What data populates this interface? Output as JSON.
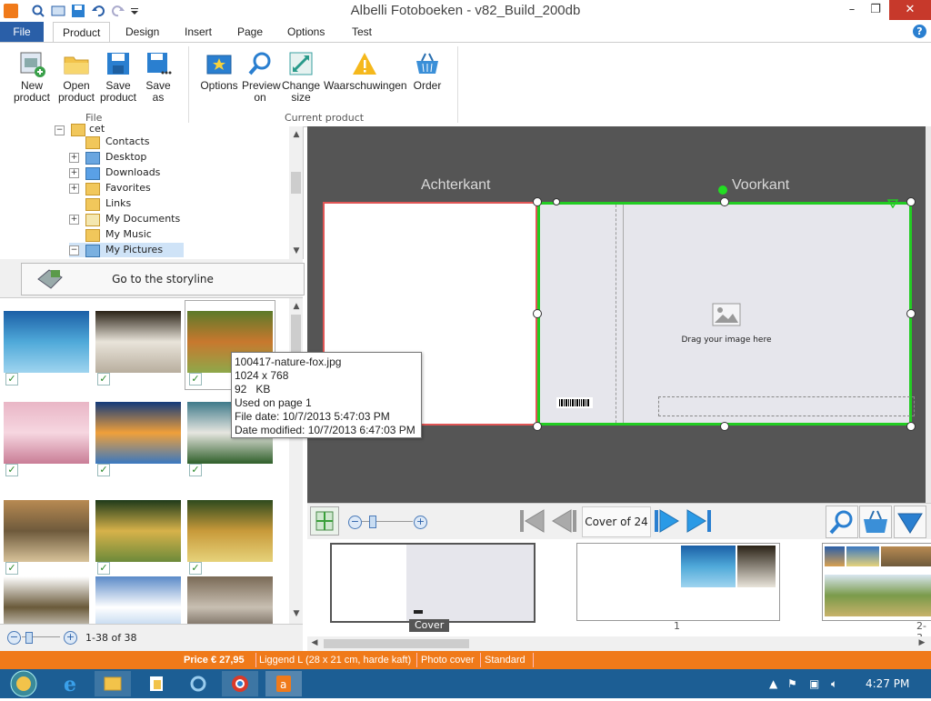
{
  "window": {
    "title": "Albelli Fotoboeken - v82_Build_200db",
    "controls": [
      "–",
      "❐",
      "✕"
    ],
    "help": "?"
  },
  "tabs": [
    "File",
    "Product",
    "Design",
    "Insert",
    "Page",
    "Options",
    "Test"
  ],
  "ribbon": {
    "file_group": {
      "label": "File",
      "buttons": [
        {
          "line1": "New",
          "line2": "product",
          "icon": "new-product-icon"
        },
        {
          "line1": "Open",
          "line2": "product",
          "icon": "open-folder-icon"
        },
        {
          "line1": "Save",
          "line2": "product",
          "icon": "save-icon"
        },
        {
          "line1": "Save",
          "line2": "as",
          "icon": "save-as-icon"
        }
      ]
    },
    "current_group": {
      "label": "Current product",
      "buttons": [
        {
          "line1": "Options",
          "line2": "",
          "icon": "options-icon"
        },
        {
          "line1": "Preview",
          "line2": "on",
          "icon": "preview-icon"
        },
        {
          "line1": "Change",
          "line2": "size",
          "icon": "change-size-icon"
        },
        {
          "line1": "Waarschuwingen",
          "line2": "",
          "icon": "warning-icon"
        },
        {
          "line1": "Order",
          "line2": "",
          "icon": "basket-icon"
        }
      ]
    }
  },
  "tree": {
    "items": [
      {
        "label": "cet",
        "expander": "−"
      },
      {
        "label": "Contacts",
        "expander": ""
      },
      {
        "label": "Desktop",
        "expander": "+"
      },
      {
        "label": "Downloads",
        "expander": "+"
      },
      {
        "label": "Favorites",
        "expander": "+"
      },
      {
        "label": "Links",
        "expander": ""
      },
      {
        "label": "My Documents",
        "expander": "+"
      },
      {
        "label": "My Music",
        "expander": ""
      },
      {
        "label": "My Pictures",
        "expander": "−"
      }
    ]
  },
  "storyline_button": "Go to the storyline",
  "thumbnails": [
    {
      "name": "dolphins",
      "colors": [
        "#1b5fa6",
        "#4fa9d9",
        "#9fd4ef"
      ]
    },
    {
      "name": "white-lion",
      "colors": [
        "#2a2216",
        "#e9e4da",
        "#b8ae9e"
      ]
    },
    {
      "name": "fox",
      "colors": [
        "#5c7a2a",
        "#c8782e",
        "#8ea84a"
      ]
    },
    {
      "name": "blossom",
      "colors": [
        "#e9b6c6",
        "#f6d6e0",
        "#c97d96"
      ]
    },
    {
      "name": "sunset-sea",
      "colors": [
        "#123a7a",
        "#f0a03a",
        "#3a78c0"
      ]
    },
    {
      "name": "waterfall",
      "colors": [
        "#3e7a8a",
        "#e6e6e0",
        "#2f5f2a"
      ]
    },
    {
      "name": "old-town",
      "colors": [
        "#b88a52",
        "#6e5a3c",
        "#d8c39a"
      ]
    },
    {
      "name": "wave",
      "colors": [
        "#1e3a1a",
        "#d7b24a",
        "#6c8a3a"
      ]
    },
    {
      "name": "autumn-tree",
      "colors": [
        "#2e4a1e",
        "#c89a3a",
        "#e6d27a"
      ]
    },
    {
      "name": "pole",
      "colors": [
        "#ffffff",
        "#6a5a3a",
        "#ffffff"
      ]
    },
    {
      "name": "glacier",
      "colors": [
        "#5a8ac8",
        "#ffffff",
        "#9cc0e6"
      ]
    },
    {
      "name": "birds",
      "colors": [
        "#7a6a56",
        "#c8bfb2",
        "#4a3e32"
      ]
    }
  ],
  "thumb_footer": {
    "count": "1-38 of 38"
  },
  "tooltip": {
    "lines": [
      "100417-nature-fox.jpg",
      "1024 x 768",
      "92   KB",
      "Used on page 1",
      "File date: 10/7/2013 5:47:03 PM",
      "Date modified: 10/7/2013 6:47:03 PM"
    ]
  },
  "cover": {
    "back_label": "Achterkant",
    "front_label": "Voorkant",
    "drop_hint": "Drag your image here",
    "colors": {
      "back_border": "#e05555",
      "front_border": "#22cc22",
      "page_fill": "#e6e6ec"
    }
  },
  "nav": {
    "page_label": "Cover of 24"
  },
  "pagestrip": {
    "labels": [
      "Cover",
      "1",
      "2-3"
    ]
  },
  "status": {
    "price": "Price € 27,95",
    "format": "Liggend L (28 x 21 cm, harde kaft)",
    "cover": "Photo cover",
    "type": "Standard"
  },
  "taskbar": {
    "time": "4:27 PM"
  }
}
